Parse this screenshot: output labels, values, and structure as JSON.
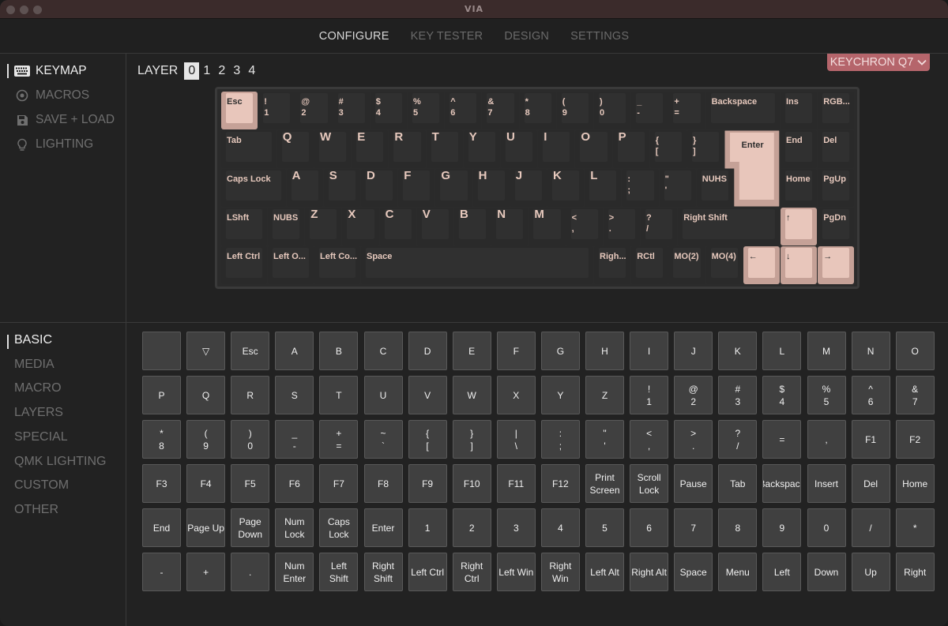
{
  "window": {
    "title": "VIA"
  },
  "topnav": {
    "tabs": [
      {
        "label": "CONFIGURE",
        "active": true
      },
      {
        "label": "KEY TESTER",
        "active": false
      },
      {
        "label": "DESIGN",
        "active": false
      },
      {
        "label": "SETTINGS",
        "active": false
      }
    ]
  },
  "sidebar": {
    "items": [
      {
        "label": "KEYMAP",
        "icon": "keyboard-icon",
        "active": true
      },
      {
        "label": "MACROS",
        "icon": "record-icon",
        "active": false
      },
      {
        "label": "SAVE + LOAD",
        "icon": "floppy-disk-icon",
        "active": false
      },
      {
        "label": "LIGHTING",
        "icon": "lightbulb-icon",
        "active": false
      }
    ]
  },
  "layers": {
    "label": "LAYER",
    "options": [
      "0",
      "1",
      "2",
      "3",
      "4"
    ],
    "selected": "0"
  },
  "keyboard_selector": {
    "label": "KEYCHRON Q7",
    "icon": "chevron-down-icon"
  },
  "keymap": {
    "rows": [
      [
        {
          "label": "Esc",
          "x": 0,
          "w": 1,
          "pink": true
        },
        {
          "label": "!\n1",
          "x": 1,
          "w": 1
        },
        {
          "label": "@\n2",
          "x": 2,
          "w": 1
        },
        {
          "label": "#\n3",
          "x": 3,
          "w": 1
        },
        {
          "label": "$\n4",
          "x": 4,
          "w": 1
        },
        {
          "label": "%\n5",
          "x": 5,
          "w": 1
        },
        {
          "label": "^\n6",
          "x": 6,
          "w": 1
        },
        {
          "label": "&\n7",
          "x": 7,
          "w": 1
        },
        {
          "label": "*\n8",
          "x": 8,
          "w": 1
        },
        {
          "label": "(\n9",
          "x": 9,
          "w": 1
        },
        {
          "label": ")\n0",
          "x": 10,
          "w": 1
        },
        {
          "label": "_\n-",
          "x": 11,
          "w": 1
        },
        {
          "label": "+\n=",
          "x": 12,
          "w": 1
        },
        {
          "label": "Backspace",
          "x": 13,
          "w": 2
        },
        {
          "label": "Ins",
          "x": 15,
          "w": 1
        },
        {
          "label": "RGB...",
          "x": 16,
          "w": 1
        }
      ],
      [
        {
          "label": "Tab",
          "x": 0,
          "w": 1.5
        },
        {
          "label": "Q",
          "x": 1.5,
          "w": 1,
          "big": true
        },
        {
          "label": "W",
          "x": 2.5,
          "w": 1,
          "big": true
        },
        {
          "label": "E",
          "x": 3.5,
          "w": 1,
          "big": true
        },
        {
          "label": "R",
          "x": 4.5,
          "w": 1,
          "big": true
        },
        {
          "label": "T",
          "x": 5.5,
          "w": 1,
          "big": true
        },
        {
          "label": "Y",
          "x": 6.5,
          "w": 1,
          "big": true
        },
        {
          "label": "U",
          "x": 7.5,
          "w": 1,
          "big": true
        },
        {
          "label": "I",
          "x": 8.5,
          "w": 1,
          "big": true
        },
        {
          "label": "O",
          "x": 9.5,
          "w": 1,
          "big": true
        },
        {
          "label": "P",
          "x": 10.5,
          "w": 1,
          "big": true
        },
        {
          "label": "{\n[",
          "x": 11.5,
          "w": 1
        },
        {
          "label": "}\n]",
          "x": 12.5,
          "w": 1
        },
        {
          "label": "End",
          "x": 15,
          "w": 1
        },
        {
          "label": "Del",
          "x": 16,
          "w": 1
        }
      ],
      [
        {
          "label": "Caps Lock",
          "x": 0,
          "w": 1.75
        },
        {
          "label": "A",
          "x": 1.75,
          "w": 1,
          "big": true
        },
        {
          "label": "S",
          "x": 2.75,
          "w": 1,
          "big": true
        },
        {
          "label": "D",
          "x": 3.75,
          "w": 1,
          "big": true
        },
        {
          "label": "F",
          "x": 4.75,
          "w": 1,
          "big": true
        },
        {
          "label": "G",
          "x": 5.75,
          "w": 1,
          "big": true
        },
        {
          "label": "H",
          "x": 6.75,
          "w": 1,
          "big": true
        },
        {
          "label": "J",
          "x": 7.75,
          "w": 1,
          "big": true
        },
        {
          "label": "K",
          "x": 8.75,
          "w": 1,
          "big": true
        },
        {
          "label": "L",
          "x": 9.75,
          "w": 1,
          "big": true
        },
        {
          "label": ":\n;",
          "x": 10.75,
          "w": 1
        },
        {
          "label": "\"\n'",
          "x": 11.75,
          "w": 1
        },
        {
          "label": "NUHS",
          "x": 12.75,
          "w": 1
        },
        {
          "label": "Home",
          "x": 15,
          "w": 1
        },
        {
          "label": "PgUp",
          "x": 16,
          "w": 1
        }
      ],
      [
        {
          "label": "LShft",
          "x": 0,
          "w": 1.25
        },
        {
          "label": "NUBS",
          "x": 1.25,
          "w": 1
        },
        {
          "label": "Z",
          "x": 2.25,
          "w": 1,
          "big": true
        },
        {
          "label": "X",
          "x": 3.25,
          "w": 1,
          "big": true
        },
        {
          "label": "C",
          "x": 4.25,
          "w": 1,
          "big": true
        },
        {
          "label": "V",
          "x": 5.25,
          "w": 1,
          "big": true
        },
        {
          "label": "B",
          "x": 6.25,
          "w": 1,
          "big": true
        },
        {
          "label": "N",
          "x": 7.25,
          "w": 1,
          "big": true
        },
        {
          "label": "M",
          "x": 8.25,
          "w": 1,
          "big": true
        },
        {
          "label": "<\n,",
          "x": 9.25,
          "w": 1
        },
        {
          "label": ">\n.",
          "x": 10.25,
          "w": 1
        },
        {
          "label": "?\n/",
          "x": 11.25,
          "w": 1
        },
        {
          "label": "Right Shift",
          "x": 12.25,
          "w": 2.75
        },
        {
          "label": "↑",
          "x": 15,
          "w": 1,
          "pink": true
        },
        {
          "label": "PgDn",
          "x": 16,
          "w": 1
        }
      ],
      [
        {
          "label": "Left Ctrl",
          "x": 0,
          "w": 1.25
        },
        {
          "label": "Left O...",
          "x": 1.25,
          "w": 1.25
        },
        {
          "label": "Left Co...",
          "x": 2.5,
          "w": 1.25
        },
        {
          "label": "Space",
          "x": 3.75,
          "w": 6.25
        },
        {
          "label": "Righ...",
          "x": 10,
          "w": 1
        },
        {
          "label": "RCtl",
          "x": 11,
          "w": 1
        },
        {
          "label": "MO(2)",
          "x": 12,
          "w": 1
        },
        {
          "label": "MO(4)",
          "x": 13,
          "w": 1
        },
        {
          "label": "←",
          "x": 14,
          "w": 1,
          "pink": true
        },
        {
          "label": "↓",
          "x": 15,
          "w": 1,
          "pink": true
        },
        {
          "label": "→",
          "x": 16,
          "w": 1,
          "pink": true
        }
      ]
    ],
    "enter_key": {
      "label": "Enter"
    }
  },
  "categories": {
    "items": [
      {
        "label": "BASIC",
        "active": true
      },
      {
        "label": "MEDIA",
        "active": false
      },
      {
        "label": "MACRO",
        "active": false
      },
      {
        "label": "LAYERS",
        "active": false
      },
      {
        "label": "SPECIAL",
        "active": false
      },
      {
        "label": "QMK LIGHTING",
        "active": false
      },
      {
        "label": "CUSTOM",
        "active": false
      },
      {
        "label": "OTHER",
        "active": false
      }
    ]
  },
  "keycodes": [
    [
      "",
      "▽",
      "Esc",
      "A",
      "B",
      "C",
      "D",
      "E",
      "F",
      "G",
      "H",
      "I",
      "J",
      "K",
      "L",
      "M",
      "N",
      "O"
    ],
    [
      "P",
      "Q",
      "R",
      "S",
      "T",
      "U",
      "V",
      "W",
      "X",
      "Y",
      "Z",
      "!\n1",
      "@\n2",
      "#\n3",
      "$\n4",
      "%\n5",
      "^\n6",
      "&\n7"
    ],
    [
      "*\n8",
      "(\n9",
      ")\n0",
      "_\n-",
      "+\n=",
      "~\n`",
      "{\n[",
      "}\n]",
      "|\n\\",
      ":\n;",
      "\"\n'",
      "<\n,",
      ">\n.",
      "?\n/",
      "=",
      ",",
      "F1",
      "F2"
    ],
    [
      "F3",
      "F4",
      "F5",
      "F6",
      "F7",
      "F8",
      "F9",
      "F10",
      "F11",
      "F12",
      "Print\nScreen",
      "Scroll\nLock",
      "Pause",
      "Tab",
      "Backspace",
      "Insert",
      "Del",
      "Home"
    ],
    [
      "End",
      "Page Up",
      "Page\nDown",
      "Num\nLock",
      "Caps\nLock",
      "Enter",
      "1",
      "2",
      "3",
      "4",
      "5",
      "6",
      "7",
      "8",
      "9",
      "0",
      "/",
      "*"
    ],
    [
      "-",
      "+",
      ".",
      "Num\nEnter",
      "Left\nShift",
      "Right\nShift",
      "Left Ctrl",
      "Right\nCtrl",
      "Left Win",
      "Right\nWin",
      "Left Alt",
      "Right Alt",
      "Space",
      "Menu",
      "Left",
      "Down",
      "Up",
      "Right"
    ]
  ],
  "colors": {
    "accent_pink": "#e8c6bb",
    "selector_bg": "#b5656b",
    "titlebar": "#3b2b2b"
  }
}
